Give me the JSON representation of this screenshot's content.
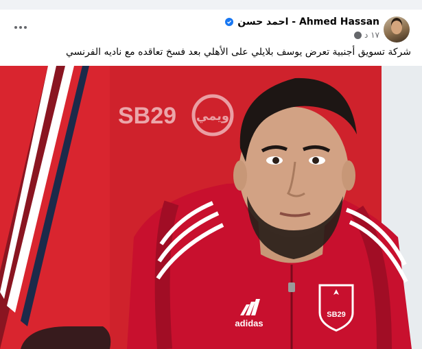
{
  "post": {
    "author_name": "احمد حسن - Ahmed Hassan",
    "timestamp": "١٧ د",
    "caption": "شركة تسويق أجنبية تعرض يوسف بلايلي على الأهلي بعد فسخ تعاقده مع ناديه الفرنسي",
    "verified": true
  },
  "photo": {
    "banner_text": "SB29",
    "banner_sub": "ويمي",
    "jersey_brand": "adidas",
    "badge_text": "SB29"
  },
  "colors": {
    "fb_blue": "#1877f2",
    "jersey_red": "#c8102e",
    "backdrop_red": "#d9252f"
  },
  "icons": {
    "more": "more-horizontal-icon",
    "verified": "verified-badge-icon",
    "privacy": "globe-icon"
  }
}
